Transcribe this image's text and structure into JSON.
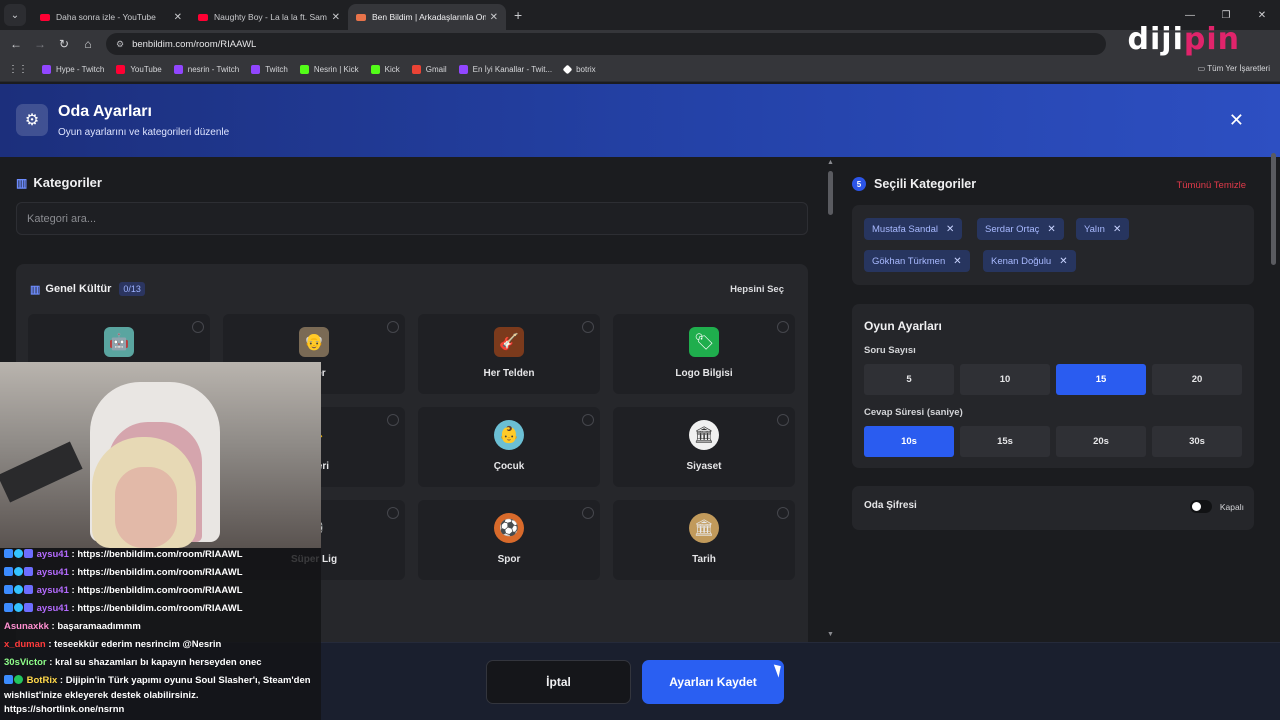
{
  "browser": {
    "tabs": [
      {
        "title": "Daha sonra izle - YouTube",
        "favicon_color": "#ff0033"
      },
      {
        "title": "Naughty Boy - La la la ft. Sam S",
        "favicon_color": "#ff0033"
      },
      {
        "title": "Ben Bildim | Arkadaşlarınla Onl",
        "favicon_color": "#e8734a"
      }
    ],
    "url": "benbildim.com/room/RIAAWL",
    "bookmarks": [
      {
        "label": "Hype - Twitch",
        "color": "#9146ff"
      },
      {
        "label": "YouTube",
        "color": "#ff0033"
      },
      {
        "label": "nesrin - Twitch",
        "color": "#9146ff"
      },
      {
        "label": "Twitch",
        "color": "#9146ff"
      },
      {
        "label": "Nesrin | Kick",
        "color": "#53fc18"
      },
      {
        "label": "Kick",
        "color": "#53fc18"
      },
      {
        "label": "Gmail",
        "color": "#ea4335"
      },
      {
        "label": "En İyi Kanallar - Twit...",
        "color": "#9146ff"
      },
      {
        "label": "botrix",
        "color": "#ffffff"
      }
    ],
    "all_bookmarks": "Tüm Yer İşaretleri"
  },
  "brand": {
    "prefix": "diji",
    "suffix": "pin"
  },
  "header": {
    "title": "Oda Ayarları",
    "subtitle": "Oyun ayarlarını ve kategorileri düzenle"
  },
  "categories": {
    "title": "Kategoriler",
    "search_placeholder": "Kategori ara...",
    "group": {
      "title": "Genel Kültür",
      "count": "0/13",
      "select_all": "Hepsini Seç",
      "cards": [
        {
          "label": "",
          "icon": "🤖",
          "bg": "#5aa5a0"
        },
        {
          "label": "işiler",
          "icon": "👴",
          "bg": "#7a6a55"
        },
        {
          "label": "Her Telden",
          "icon": "🎸",
          "bg": "#7b3a1c"
        },
        {
          "label": "Logo Bilgisi",
          "icon": "🏷",
          "bg": "#1fae4d"
        },
        {
          "label": "",
          "icon": "",
          "bg": "#2a2b2f"
        },
        {
          "label": "lüpleri",
          "icon": "◆",
          "bg": "#d49a00"
        },
        {
          "label": "Çocuk",
          "icon": "👶",
          "bg": "#6bbfd4"
        },
        {
          "label": "Siyaset",
          "icon": "🏛",
          "bg": "#f0f0f0"
        },
        {
          "label": "",
          "icon": "",
          "bg": "#2a2b2f"
        },
        {
          "label": "Süper Lig",
          "icon": "⚽",
          "bg": "#c0262c"
        },
        {
          "label": "Spor",
          "icon": "⚽",
          "bg": "#d86a2b"
        },
        {
          "label": "Tarih",
          "icon": "🏛",
          "bg": "#c19a5b"
        }
      ]
    }
  },
  "selected": {
    "count": "5",
    "title": "Seçili Kategoriler",
    "clear": "Tümünü Temizle",
    "chips": [
      "Mustafa Sandal",
      "Serdar Ortaç",
      "Yalın",
      "Gökhan Türkmen",
      "Kenan Doğulu"
    ]
  },
  "game_settings": {
    "title": "Oyun Ayarları",
    "question_count_label": "Soru Sayısı",
    "question_counts": [
      "5",
      "10",
      "15",
      "20"
    ],
    "question_count_selected": "15",
    "answer_time_label": "Cevap Süresi (saniye)",
    "answer_times": [
      "10s",
      "15s",
      "20s",
      "30s"
    ],
    "answer_time_selected": "10s"
  },
  "password": {
    "label": "Oda Şifresi",
    "state": "Kapalı",
    "enabled": false
  },
  "footer": {
    "cancel": "İptal",
    "save": "Ayarları Kaydet"
  },
  "chat": [
    {
      "user": "aysu41",
      "color": "#b46bff",
      "text": ": https://benbildim.com/room/RIAAWL"
    },
    {
      "user": "aysu41",
      "color": "#b46bff",
      "text": ": https://benbildim.com/room/RIAAWL"
    },
    {
      "user": "aysu41",
      "color": "#b46bff",
      "text": ": https://benbildim.com/room/RIAAWL"
    },
    {
      "user": "aysu41",
      "color": "#b46bff",
      "text": ": https://benbildim.com/room/RIAAWL"
    },
    {
      "user": "Asunaxkk",
      "color": "#ff8fd0",
      "text": ": başaramaadımmm"
    },
    {
      "user": "x_duman",
      "color": "#ff3b3b",
      "text": ": teseekkür ederim nesrincim @Nesrin"
    },
    {
      "user": "30sVictor",
      "color": "#8fff8a",
      "text": ": kral su shazamları bı kapayın herseyden onec"
    },
    {
      "user": "BotRix",
      "color": "#ffd84a",
      "text": ": Dijipin'in Türk yapımı oyunu Soul Slasher'ı, Steam'den wishlist'inize ekleyerek destek olabilirsiniz. https://shortlink.one/nsrnn"
    }
  ]
}
